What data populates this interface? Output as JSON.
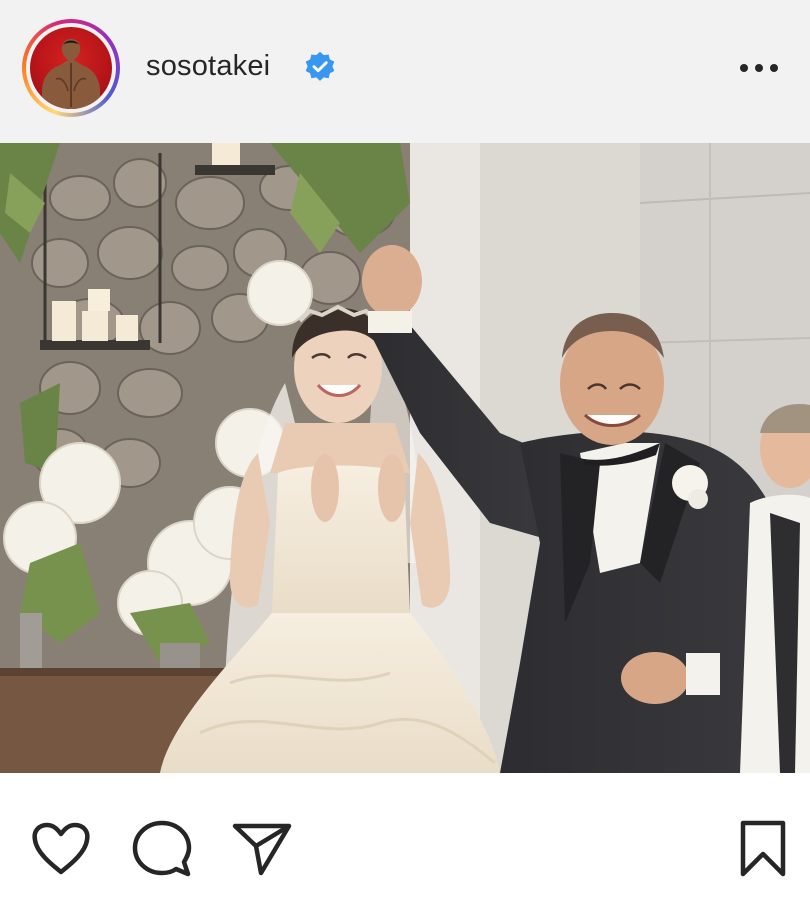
{
  "post": {
    "username": "sosotakei",
    "verified": true,
    "avatar_icon": "profile-photo",
    "more_icon": "more-options-icon"
  },
  "colors": {
    "header_bg": "#f2f2f2",
    "verified_blue": "#3897f0",
    "icon": "#262626"
  },
  "actions": {
    "like_icon": "heart-icon",
    "comment_icon": "comment-icon",
    "share_icon": "paper-plane-icon",
    "save_icon": "bookmark-icon"
  }
}
